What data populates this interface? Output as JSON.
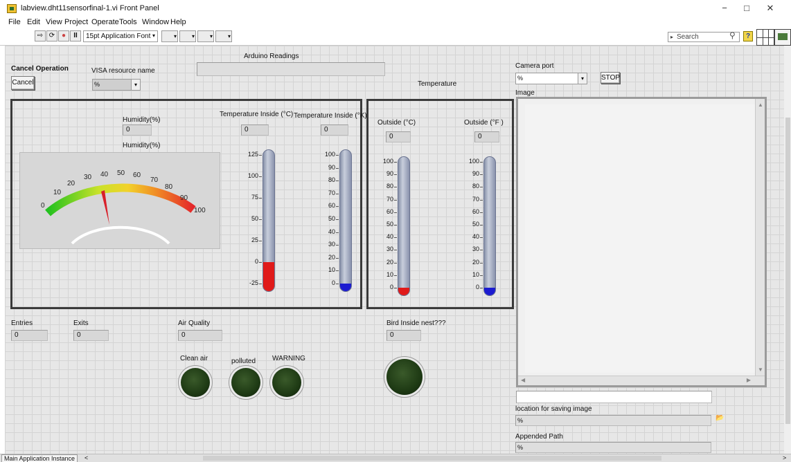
{
  "window": {
    "title": "labview.dht11sensorfinal-1.vi Front Panel",
    "minimize": "−",
    "restore": "□",
    "close": "✕"
  },
  "menubar": [
    "File",
    "Edit",
    "View",
    "Project",
    "Operate",
    "Tools",
    "Window",
    "Help"
  ],
  "toolbar": {
    "font": "15pt Application Font",
    "search_placeholder": "Search",
    "help": "?"
  },
  "panel": {
    "cancel_operation_label": "Cancel Operation",
    "cancel_button": "Cancel",
    "visa_label": "VISA resource name",
    "visa_value": "%",
    "arduino_label": "Arduino Readings",
    "arduino_value": "",
    "temperature_title": "Temperature",
    "humidity_label": "Humidity(%)",
    "humidity_value": "0",
    "humidity_gauge_label": "Humidity(%)",
    "humidity_gauge_value": 35,
    "gauge_ticks": [
      "0",
      "10",
      "20",
      "30",
      "40",
      "50",
      "60",
      "70",
      "80",
      "90",
      "100"
    ],
    "temp_in_c_label": "Temperature Inside (°C)",
    "temp_in_c_value": "0",
    "temp_in_k_label": "Temperature Inside (°K)",
    "temp_in_k_value": "0",
    "thermo_c_ticks": [
      "125",
      "100",
      "75",
      "50",
      "25",
      "0",
      "-25"
    ],
    "thermo_c_level": 0,
    "thermo_k_ticks": [
      "100",
      "90",
      "80",
      "70",
      "60",
      "50",
      "40",
      "30",
      "20",
      "10",
      "0"
    ],
    "thermo_k_level": 0,
    "outside_c_label": "Outside (°C)",
    "outside_c_value": "0",
    "outside_f_label": "Outside (°F )",
    "outside_f_value": "0",
    "thermo_out_ticks": [
      "100",
      "90",
      "80",
      "70",
      "60",
      "50",
      "40",
      "30",
      "20",
      "10",
      "0"
    ],
    "thermo_out_c_level": 0,
    "thermo_out_f_level": 0,
    "entries_label": "Entries",
    "entries_value": "0",
    "exits_label": "Exits",
    "exits_value": "0",
    "air_quality_label": "Air Quality",
    "air_quality_value": "0",
    "clean_air_label": "Clean air",
    "polluted_label": "polluted",
    "warning_label": "WARNING",
    "bird_label": "Bird Inside nest???",
    "bird_value": "0",
    "camera_port_label": "Camera port",
    "camera_port_value": "%",
    "stop_button": "STOP",
    "image_label": "Image",
    "save_location_label": "location for saving image",
    "save_location_value": "%",
    "appended_path_label": "Appended Path",
    "appended_path_value": "%"
  },
  "status": {
    "instance": "Main Application Instance"
  },
  "colors": {
    "gauge_low": "#22c11f",
    "gauge_mid": "#f2d22a",
    "gauge_high": "#e4262a",
    "thermo_red": "#e01a1a",
    "thermo_blue": "#1b1bd0",
    "led_off": "#1e3a14"
  }
}
